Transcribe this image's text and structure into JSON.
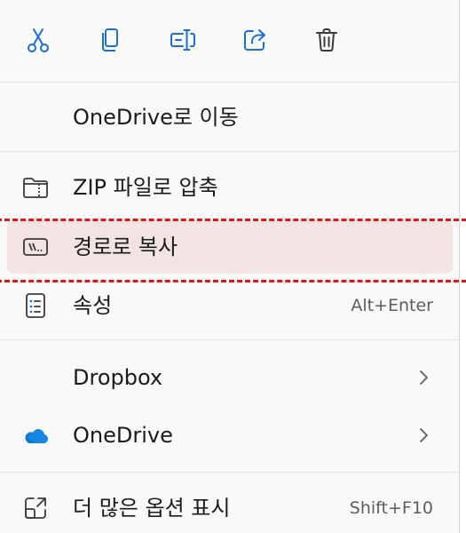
{
  "toolbar": {
    "buttons": [
      {
        "name": "cut-button",
        "icon": "scissors-icon"
      },
      {
        "name": "copy-button",
        "icon": "copy-icon"
      },
      {
        "name": "rename-button",
        "icon": "rename-icon"
      },
      {
        "name": "share-button",
        "icon": "share-icon"
      },
      {
        "name": "delete-button",
        "icon": "trash-icon"
      }
    ]
  },
  "menu": {
    "move_to_onedrive": "OneDrive로 이동",
    "zip": "ZIP 파일로 압축",
    "copy_path": "경로로 복사",
    "properties": "속성",
    "properties_shortcut": "Alt+Enter",
    "dropbox": "Dropbox",
    "onedrive": "OneDrive",
    "more_options": "더 많은 옵션 표시",
    "more_options_shortcut": "Shift+F10"
  },
  "colors": {
    "accent": "#1c6ed4",
    "highlight_bg": "#f3e4e4",
    "annotation_red": "#e0161a",
    "onedrive_blue": "#0f78d4"
  }
}
